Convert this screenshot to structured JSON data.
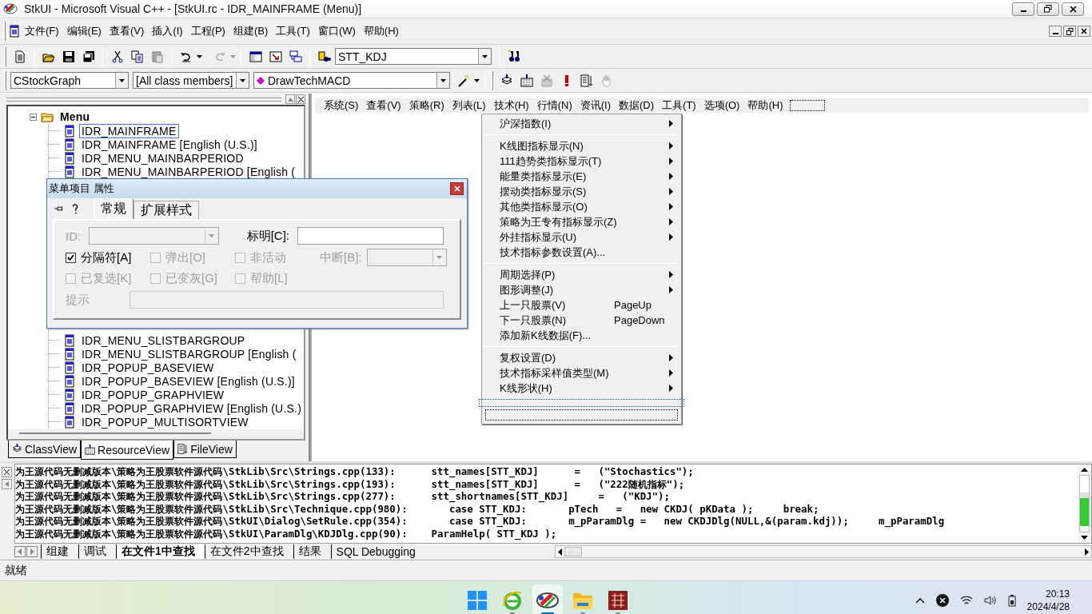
{
  "window": {
    "title": "StkUI - Microsoft Visual C++ - [StkUI.rc - IDR_MAINFRAME (Menu)]"
  },
  "menubar": [
    "文件(F)",
    "编辑(E)",
    "查看(V)",
    "插入(I)",
    "工程(P)",
    "组建(B)",
    "工具(T)",
    "窗口(W)",
    "帮助(H)"
  ],
  "toolbar": {
    "config_combo": "STT_KDJ"
  },
  "wizardbar": {
    "class_combo": "CStockGraph",
    "filter_combo": "[All class members]",
    "member_combo": "DrawTechMACD"
  },
  "workspace": {
    "tree": {
      "label": "Menu",
      "expanded": true,
      "children": [
        {
          "label": "IDR_MAINFRAME",
          "selected": true
        },
        {
          "label": "IDR_MAINFRAME [English (U.S.)]",
          "selected": false
        },
        {
          "label": "IDR_MENU_MAINBARPERIOD",
          "selected": false
        },
        {
          "label": "IDR_MENU_MAINBARPERIOD [English (",
          "selected": false
        },
        {
          "label": "IDR_MENU_SLISTBARGROUP",
          "selected": false
        },
        {
          "label": "IDR_MENU_SLISTBARGROUP [English (",
          "selected": false
        },
        {
          "label": "IDR_POPUP_BASEVIEW",
          "selected": false
        },
        {
          "label": "IDR_POPUP_BASEVIEW [English (U.S.)]",
          "selected": false
        },
        {
          "label": "IDR_POPUP_GRAPHVIEW",
          "selected": false
        },
        {
          "label": "IDR_POPUP_GRAPHVIEW [English (U.S.)",
          "selected": false
        },
        {
          "label": "IDR_POPUP_MULTISORTVIEW",
          "selected": false
        }
      ]
    },
    "tabs": [
      {
        "label": "ClassView",
        "selected": false
      },
      {
        "label": "ResourceView",
        "selected": true
      },
      {
        "label": "FileView",
        "selected": false
      }
    ]
  },
  "dialog": {
    "title": "菜单项目 属性",
    "tabs": [
      {
        "label": "常规",
        "selected": true
      },
      {
        "label": "扩展样式",
        "selected": false
      }
    ],
    "id_field": {
      "label": "ID:",
      "disabled": true
    },
    "caption_field": {
      "label": "标明[C]:",
      "disabled": false
    },
    "checkboxes": [
      {
        "label": "分隔符[A]",
        "checked": true,
        "disabled": false
      },
      {
        "label": "弹出[O]",
        "checked": false,
        "disabled": true
      },
      {
        "label": "非活动",
        "checked": false,
        "disabled": true
      },
      {
        "label": "已复选[K]",
        "checked": false,
        "disabled": true
      },
      {
        "label": "已变灰[G]",
        "checked": false,
        "disabled": true
      },
      {
        "label": "帮助[L]",
        "checked": false,
        "disabled": true
      }
    ],
    "break_field": {
      "label": "中断[B]:",
      "disabled": true
    },
    "prompt_field": {
      "label": "提示",
      "disabled": true
    }
  },
  "editor": {
    "menubar": [
      "系统(S)",
      "查看(V)",
      "策略(R)",
      "列表(L)",
      "技术(H)",
      "行情(N)",
      "资讯(I)",
      "数据(D)",
      "工具(T)",
      "选项(O)",
      "帮助(H)"
    ],
    "popup": [
      {
        "kind": "item",
        "label": "沪深指数(I)",
        "submenu": true
      },
      {
        "kind": "separator"
      },
      {
        "kind": "item",
        "label": "K线图指标显示(N)",
        "submenu": true
      },
      {
        "kind": "item",
        "label": "111趋势类指标显示(T)",
        "submenu": true
      },
      {
        "kind": "item",
        "label": "能量类指标显示(E)",
        "submenu": true
      },
      {
        "kind": "item",
        "label": "摆动类指标显示(S)",
        "submenu": true
      },
      {
        "kind": "item",
        "label": "其他类指标显示(O)",
        "submenu": true
      },
      {
        "kind": "item",
        "label": "策略为王专有指标显示(Z)",
        "submenu": true
      },
      {
        "kind": "item",
        "label": "外挂指标显示(U)",
        "submenu": true
      },
      {
        "kind": "item",
        "label": "技术指标参数设置(A)...",
        "submenu": false
      },
      {
        "kind": "separator"
      },
      {
        "kind": "item",
        "label": "周期选择(P)",
        "submenu": true
      },
      {
        "kind": "item",
        "label": "图形调整(J)",
        "submenu": true
      },
      {
        "kind": "item",
        "label": "上一只股票(V)",
        "submenu": false,
        "shortcut": "PageUp"
      },
      {
        "kind": "item",
        "label": "下一只股票(N)",
        "submenu": false,
        "shortcut": "PageDown"
      },
      {
        "kind": "item",
        "label": "添加新K线数据(F)...",
        "submenu": false
      },
      {
        "kind": "separator"
      },
      {
        "kind": "item",
        "label": "复权设置(D)",
        "submenu": true
      },
      {
        "kind": "item",
        "label": "技术指标采样值类型(M)",
        "submenu": true
      },
      {
        "kind": "item",
        "label": "K线形状(H)",
        "submenu": true
      }
    ]
  },
  "output": {
    "lines": [
      "为王源代码无删减版本\\策略为王股票软件源代码\\StkLib\\Src\\Strings.cpp(133):      stt_names[STT_KDJ]      =   (\"Stochastics\");",
      "为王源代码无删减版本\\策略为王股票软件源代码\\StkLib\\Src\\Strings.cpp(193):      stt_names[STT_KDJ]      =   (\"222随机指标\");",
      "为王源代码无删减版本\\策略为王股票软件源代码\\StkLib\\Src\\Strings.cpp(277):      stt_shortnames[STT_KDJ]     =   (\"KDJ\");",
      "为王源代码无删减版本\\策略为王股票软件源代码\\StkLib\\Src\\Technique.cpp(980):       case STT_KDJ:       pTech   =   new CKDJ( pKData );     break;",
      "为王源代码无删减版本\\策略为王股票软件源代码\\StkUI\\Dialog\\SetRule.cpp(354):       case STT_KDJ:       m_pParamDlg =   new CKDJDlg(NULL,&(param.kdj));     m_pParamDlg",
      "为王源代码无删减版本\\策略为王股票软件源代码\\StkUI\\ParamDlg\\KDJDlg.cpp(90):    ParamHelp( STT_KDJ );"
    ],
    "tabs": [
      {
        "label": "组建",
        "selected": false
      },
      {
        "label": "调试",
        "selected": false
      },
      {
        "label": "在文件1中查找",
        "selected": true
      },
      {
        "label": "在文件2中查找",
        "selected": false
      },
      {
        "label": "结果",
        "selected": false
      },
      {
        "label": "SQL Debugging",
        "selected": false
      }
    ]
  },
  "status_bar": "就绪",
  "taskbar": {
    "time": "20:13",
    "date": "2024/4/28"
  }
}
